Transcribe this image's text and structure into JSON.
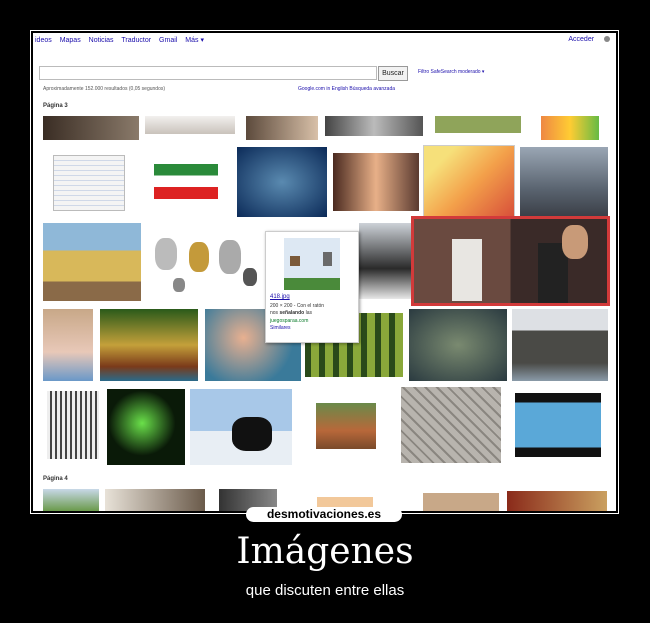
{
  "nav": {
    "links": [
      "ideos",
      "Mapas",
      "Noticias",
      "Traductor",
      "Gmail",
      "Más ▾"
    ],
    "signin": "Acceder"
  },
  "search": {
    "button": "Buscar",
    "safesearch": "Filtro SafeSearch moderado ▾",
    "results": "Aproximadamente 152.000 resultados (0,05 segundos)",
    "advanced": "Google.com in English  Búsqueda avanzada"
  },
  "pages": {
    "p3": "Página 3",
    "p4": "Página 4"
  },
  "popup": {
    "title": "418.jpg",
    "dims": "200 × 200 - Con el ratón",
    "line2_pre": "nos ",
    "line2_bold": "señalando",
    "line2_post": " las",
    "domain": "juegosparaa.com",
    "similar": "Similares"
  },
  "poster": {
    "logo": "desmotivaciones.es",
    "title": "Imágenes",
    "subtitle": "que discuten entre ellas"
  },
  "colors": {
    "selection_border": "#d23a3a",
    "link": "#1a0dab"
  },
  "icons": {
    "settings": "gear-icon"
  }
}
